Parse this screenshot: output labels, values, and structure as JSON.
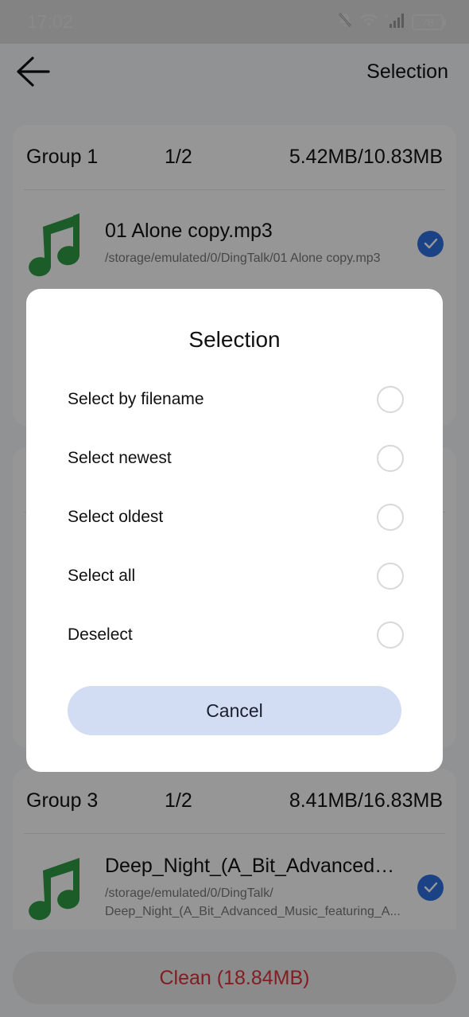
{
  "status_bar": {
    "time": "17:02",
    "icons": [
      "bell-muted-icon",
      "wifi-icon",
      "signal-no-service-icon"
    ],
    "battery": "78"
  },
  "app_bar": {
    "back_icon": "arrow-left-icon",
    "action_label": "Selection"
  },
  "groups": [
    {
      "name": "Group 1",
      "count": "1/2",
      "size": "5.42MB/10.83MB",
      "files": [
        {
          "icon": "music-note-icon",
          "name": "01 Alone copy.mp3",
          "path": "/storage/emulated/0/DingTalk/01 Alone copy.mp3",
          "checked": true
        }
      ]
    },
    {
      "name": "Group 3",
      "count": "1/2",
      "size": "8.41MB/16.83MB",
      "files": [
        {
          "icon": "music-note-icon",
          "name": "Deep_Night_(A_Bit_Advanced_...",
          "path_line1": "/storage/emulated/0/DingTalk/",
          "path_line2": "Deep_Night_(A_Bit_Advanced_Music_featuring_A...",
          "checked": true
        }
      ]
    }
  ],
  "clean_button": {
    "label": "Clean (18.84MB)",
    "color": "#d9323a"
  },
  "dialog": {
    "title": "Selection",
    "options": [
      {
        "label": "Select by filename",
        "selected": false
      },
      {
        "label": "Select newest",
        "selected": false
      },
      {
        "label": "Select oldest",
        "selected": false
      },
      {
        "label": "Select all",
        "selected": false
      },
      {
        "label": "Deselect",
        "selected": false
      }
    ],
    "cancel_label": "Cancel"
  },
  "colors": {
    "accent": "#2f6fe0",
    "music_icon": "#2e9a45",
    "cancel_bg": "#d2dcf3"
  }
}
